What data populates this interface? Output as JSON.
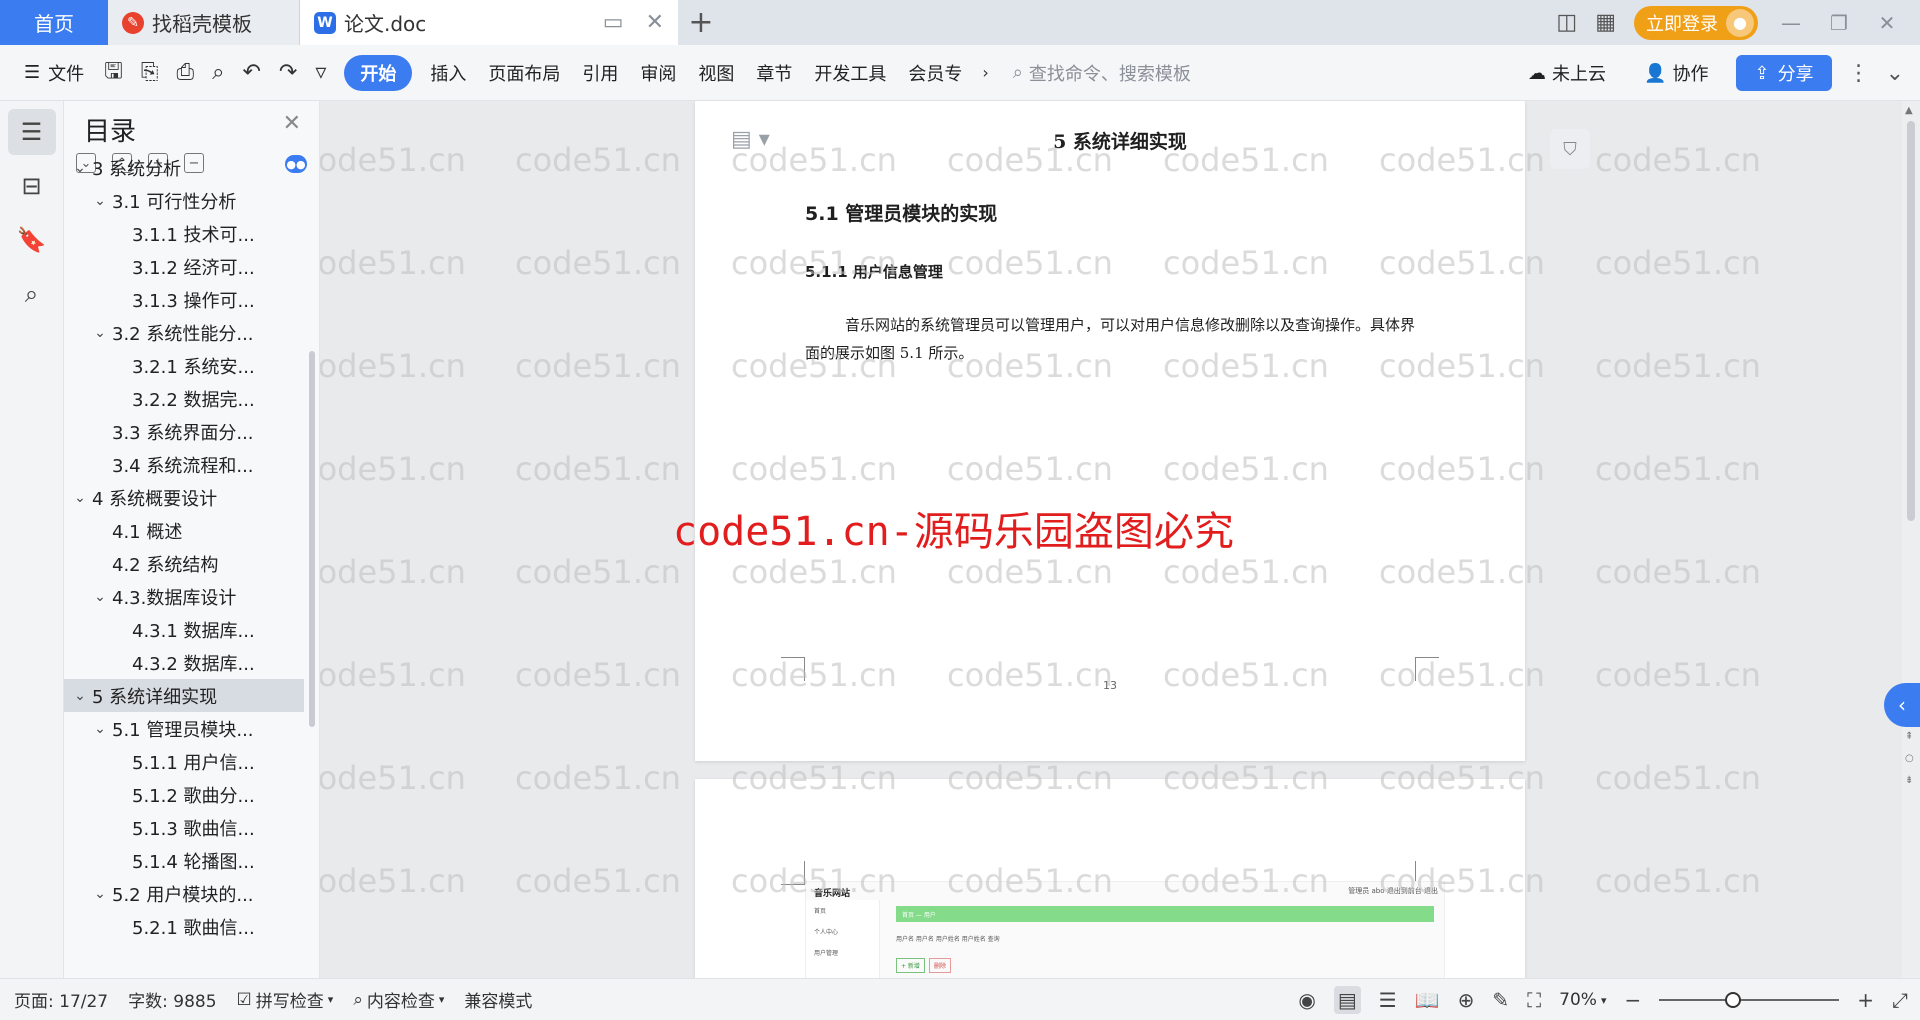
{
  "tabs": {
    "home": "首页",
    "template": "找稻壳模板",
    "doc": "论文.doc"
  },
  "header": {
    "login": "立即登录",
    "layout_icon": "reading-layout-icon",
    "grid_icon": "apps-grid-icon"
  },
  "ribbon": {
    "file": "文件",
    "tabs": [
      "开始",
      "插入",
      "页面布局",
      "引用",
      "审阅",
      "视图",
      "章节",
      "开发工具",
      "会员专"
    ],
    "search_placeholder": "查找命令、搜索模板",
    "cloud": "未上云",
    "collab": "协作",
    "share": "分享"
  },
  "toc": {
    "title": "目录",
    "items": [
      {
        "level": 1,
        "text": "3 系统分析",
        "expanded": true
      },
      {
        "level": 2,
        "text": "3.1 可行性分析",
        "expanded": true
      },
      {
        "level": 3,
        "text": "3.1.1 技术可..."
      },
      {
        "level": 3,
        "text": "3.1.2 经济可..."
      },
      {
        "level": 3,
        "text": "3.1.3 操作可..."
      },
      {
        "level": 2,
        "text": "3.2 系统性能分...",
        "expanded": true
      },
      {
        "level": 3,
        "text": "3.2.1  系统安..."
      },
      {
        "level": 3,
        "text": "3.2.2  数据完..."
      },
      {
        "level": 2,
        "text": "3.3 系统界面分..."
      },
      {
        "level": 2,
        "text": "3.4 系统流程和..."
      },
      {
        "level": 1,
        "text": "4 系统概要设计",
        "expanded": true
      },
      {
        "level": 2,
        "text": "4.1 概述"
      },
      {
        "level": 2,
        "text": "4.2 系统结构"
      },
      {
        "level": 2,
        "text": "4.3.数据库设计",
        "expanded": true
      },
      {
        "level": 3,
        "text": "4.3.1 数据库..."
      },
      {
        "level": 3,
        "text": "4.3.2 数据库..."
      },
      {
        "level": 1,
        "text": "5 系统详细实现",
        "expanded": true,
        "selected": true
      },
      {
        "level": 2,
        "text": "5.1  管理员模块...",
        "expanded": true
      },
      {
        "level": 3,
        "text": "5.1.1  用户信..."
      },
      {
        "level": 3,
        "text": "5.1.2  歌曲分..."
      },
      {
        "level": 3,
        "text": "5.1.3  歌曲信..."
      },
      {
        "level": 3,
        "text": "5.1.4  轮播图..."
      },
      {
        "level": 2,
        "text": "5.2  用户模块的...",
        "expanded": true
      },
      {
        "level": 3,
        "text": "5.2.1  歌曲信..."
      }
    ]
  },
  "page": {
    "header": "5 系统详细实现",
    "h2": "5.1  管理员模块的实现",
    "h3": "5.1.1  用户信息管理",
    "para": "音乐网站的系统管理员可以管理用户，可以对用户信息修改删除以及查询操作。具体界面的展示如图 5.1 所示。",
    "page_number": "13",
    "piracy_notice": "code51.cn-源码乐园盗图必究",
    "watermark": "code51.cn"
  },
  "mini_screenshot": {
    "title": "音乐网站",
    "right": "管理员 abo   退出到前台   退出",
    "side": [
      "首页",
      "个人中心",
      "用户管理"
    ],
    "bar": "首页  —  用户",
    "row": "用户名   用户名        用户姓名   用户姓名          查询",
    "btn_add": "+ 新增",
    "btn_del": "删除"
  },
  "status": {
    "page": "页面: 17/27",
    "words": "字数: 9885",
    "spell": "拼写检查",
    "content": "内容检查",
    "compat": "兼容模式",
    "zoom": "70%"
  },
  "colors": {
    "accent": "#3b7cf0",
    "login": "#f0a017",
    "piracy": "#e11d1d"
  }
}
